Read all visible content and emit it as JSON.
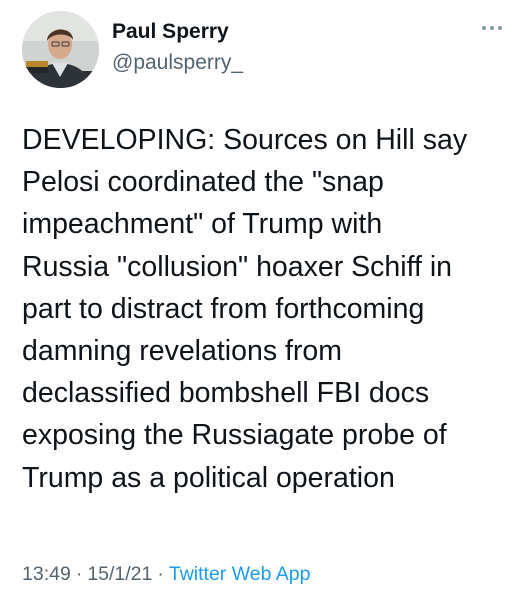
{
  "author": {
    "name": "Paul Sperry",
    "handle": "@paulsperry_",
    "avatar_icon": "profile-photo"
  },
  "tweet": {
    "lines": [
      "DEVELOPING: Sources on Hill say",
      "Pelosi coordinated the \"snap",
      "impeachment\" of Trump with",
      "Russia \"collusion\" hoaxer Schiff in",
      "part to distract from forthcoming",
      "damning revelations from",
      "declassified bombshell FBI docs",
      "exposing the Russiagate probe of",
      "Trump as a political operation"
    ],
    "time": "13:49",
    "date": "15/1/21",
    "separator": "·",
    "source": "Twitter Web App"
  },
  "actions": {
    "more_icon": "more-horizontal-icon"
  },
  "colors": {
    "text": "#0f1419",
    "secondary": "#536471",
    "link": "#1d9bf0",
    "background": "#ffffff"
  }
}
